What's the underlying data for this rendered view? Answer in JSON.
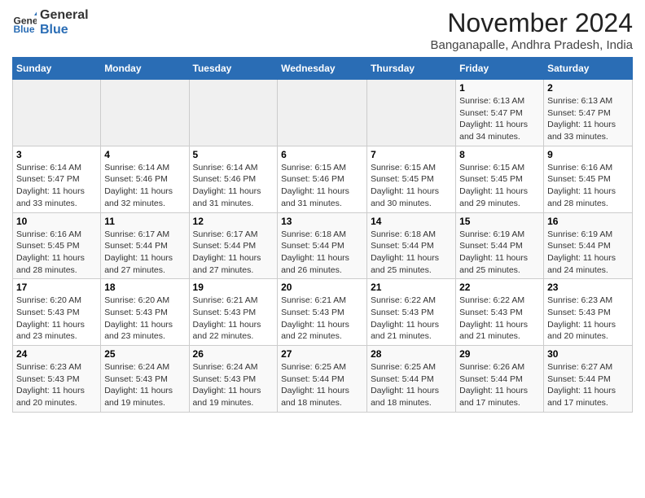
{
  "header": {
    "logo_line1": "General",
    "logo_line2": "Blue",
    "month_title": "November 2024",
    "location": "Banganapalle, Andhra Pradesh, India"
  },
  "days_of_week": [
    "Sunday",
    "Monday",
    "Tuesday",
    "Wednesday",
    "Thursday",
    "Friday",
    "Saturday"
  ],
  "weeks": [
    [
      {
        "day": "",
        "info": ""
      },
      {
        "day": "",
        "info": ""
      },
      {
        "day": "",
        "info": ""
      },
      {
        "day": "",
        "info": ""
      },
      {
        "day": "",
        "info": ""
      },
      {
        "day": "1",
        "info": "Sunrise: 6:13 AM\nSunset: 5:47 PM\nDaylight: 11 hours and 34 minutes."
      },
      {
        "day": "2",
        "info": "Sunrise: 6:13 AM\nSunset: 5:47 PM\nDaylight: 11 hours and 33 minutes."
      }
    ],
    [
      {
        "day": "3",
        "info": "Sunrise: 6:14 AM\nSunset: 5:47 PM\nDaylight: 11 hours and 33 minutes."
      },
      {
        "day": "4",
        "info": "Sunrise: 6:14 AM\nSunset: 5:46 PM\nDaylight: 11 hours and 32 minutes."
      },
      {
        "day": "5",
        "info": "Sunrise: 6:14 AM\nSunset: 5:46 PM\nDaylight: 11 hours and 31 minutes."
      },
      {
        "day": "6",
        "info": "Sunrise: 6:15 AM\nSunset: 5:46 PM\nDaylight: 11 hours and 31 minutes."
      },
      {
        "day": "7",
        "info": "Sunrise: 6:15 AM\nSunset: 5:45 PM\nDaylight: 11 hours and 30 minutes."
      },
      {
        "day": "8",
        "info": "Sunrise: 6:15 AM\nSunset: 5:45 PM\nDaylight: 11 hours and 29 minutes."
      },
      {
        "day": "9",
        "info": "Sunrise: 6:16 AM\nSunset: 5:45 PM\nDaylight: 11 hours and 28 minutes."
      }
    ],
    [
      {
        "day": "10",
        "info": "Sunrise: 6:16 AM\nSunset: 5:45 PM\nDaylight: 11 hours and 28 minutes."
      },
      {
        "day": "11",
        "info": "Sunrise: 6:17 AM\nSunset: 5:44 PM\nDaylight: 11 hours and 27 minutes."
      },
      {
        "day": "12",
        "info": "Sunrise: 6:17 AM\nSunset: 5:44 PM\nDaylight: 11 hours and 27 minutes."
      },
      {
        "day": "13",
        "info": "Sunrise: 6:18 AM\nSunset: 5:44 PM\nDaylight: 11 hours and 26 minutes."
      },
      {
        "day": "14",
        "info": "Sunrise: 6:18 AM\nSunset: 5:44 PM\nDaylight: 11 hours and 25 minutes."
      },
      {
        "day": "15",
        "info": "Sunrise: 6:19 AM\nSunset: 5:44 PM\nDaylight: 11 hours and 25 minutes."
      },
      {
        "day": "16",
        "info": "Sunrise: 6:19 AM\nSunset: 5:44 PM\nDaylight: 11 hours and 24 minutes."
      }
    ],
    [
      {
        "day": "17",
        "info": "Sunrise: 6:20 AM\nSunset: 5:43 PM\nDaylight: 11 hours and 23 minutes."
      },
      {
        "day": "18",
        "info": "Sunrise: 6:20 AM\nSunset: 5:43 PM\nDaylight: 11 hours and 23 minutes."
      },
      {
        "day": "19",
        "info": "Sunrise: 6:21 AM\nSunset: 5:43 PM\nDaylight: 11 hours and 22 minutes."
      },
      {
        "day": "20",
        "info": "Sunrise: 6:21 AM\nSunset: 5:43 PM\nDaylight: 11 hours and 22 minutes."
      },
      {
        "day": "21",
        "info": "Sunrise: 6:22 AM\nSunset: 5:43 PM\nDaylight: 11 hours and 21 minutes."
      },
      {
        "day": "22",
        "info": "Sunrise: 6:22 AM\nSunset: 5:43 PM\nDaylight: 11 hours and 21 minutes."
      },
      {
        "day": "23",
        "info": "Sunrise: 6:23 AM\nSunset: 5:43 PM\nDaylight: 11 hours and 20 minutes."
      }
    ],
    [
      {
        "day": "24",
        "info": "Sunrise: 6:23 AM\nSunset: 5:43 PM\nDaylight: 11 hours and 20 minutes."
      },
      {
        "day": "25",
        "info": "Sunrise: 6:24 AM\nSunset: 5:43 PM\nDaylight: 11 hours and 19 minutes."
      },
      {
        "day": "26",
        "info": "Sunrise: 6:24 AM\nSunset: 5:43 PM\nDaylight: 11 hours and 19 minutes."
      },
      {
        "day": "27",
        "info": "Sunrise: 6:25 AM\nSunset: 5:44 PM\nDaylight: 11 hours and 18 minutes."
      },
      {
        "day": "28",
        "info": "Sunrise: 6:25 AM\nSunset: 5:44 PM\nDaylight: 11 hours and 18 minutes."
      },
      {
        "day": "29",
        "info": "Sunrise: 6:26 AM\nSunset: 5:44 PM\nDaylight: 11 hours and 17 minutes."
      },
      {
        "day": "30",
        "info": "Sunrise: 6:27 AM\nSunset: 5:44 PM\nDaylight: 11 hours and 17 minutes."
      }
    ]
  ]
}
